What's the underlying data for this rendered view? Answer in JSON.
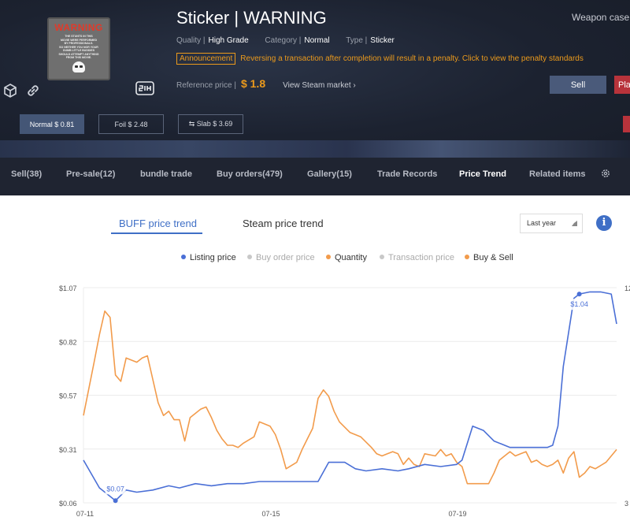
{
  "item": {
    "thumbnail": {
      "warning": "WARNING",
      "lines": [
        "THE STUNTS IN THIS",
        "MOVIE WERE PERFORMED",
        "BY PROFESSIONALS.",
        "SO NEITHER YOU NOR YOUR",
        "DUMB LITTLE BUDDIES",
        "SHOULD ATTEMPT ANYTHING",
        "FROM THIS MOVIE."
      ]
    },
    "title": "Sticker | WARNING",
    "weapon_case": "Weapon case",
    "quality_label": "Quality |",
    "quality": "High Grade",
    "category_label": "Category |",
    "category": "Normal",
    "type_label": "Type |",
    "type": "Sticker",
    "announcement_tag": "Announcement",
    "announcement_text": "Reversing a transaction after completion will result in a penalty. Click to view the penalty standards",
    "reference_label": "Reference price |",
    "reference_price": "$ 1.8",
    "view_steam": "View Steam market ›",
    "sell_button": "Sell",
    "place_button": "Pla"
  },
  "variants": [
    {
      "label": "Normal $ 0.81",
      "active": true
    },
    {
      "label": "Foil $ 2.48",
      "active": false
    },
    {
      "label": "⇆ Slab $ 3.69",
      "active": false
    }
  ],
  "tabs": [
    "Sell(38)",
    "Pre-sale(12)",
    "bundle trade",
    "Buy orders(479)",
    "Gallery(15)",
    "Trade Records",
    "Price Trend",
    "Related items"
  ],
  "active_tab": "Price Trend",
  "chart_controls": {
    "buff_toggle": "BUFF price trend",
    "steam_toggle": "Steam price trend",
    "range": "Last year"
  },
  "legend": [
    {
      "name": "Listing price",
      "color": "#4a6fd6",
      "active": true
    },
    {
      "name": "Buy order price",
      "color": "#c8c8c8",
      "active": false
    },
    {
      "name": "Quantity",
      "color": "#f29b4b",
      "active": true
    },
    {
      "name": "Transaction price",
      "color": "#c8c8c8",
      "active": false
    },
    {
      "name": "Buy & Sell",
      "color": "#f29b4b",
      "active": true
    }
  ],
  "chart_data": {
    "type": "line",
    "y_ticks": [
      "$1.07",
      "$0.82",
      "$0.57",
      "$0.31",
      "$0.06"
    ],
    "ylim": [
      0.06,
      1.07
    ],
    "right_ticks": [
      "12",
      "3"
    ],
    "x_ticks": [
      "07-11",
      "07-15",
      "07-19"
    ],
    "grid": true,
    "annotations": [
      {
        "label": "$0.07",
        "series": "Listing price",
        "x": 6,
        "y": 0.07
      },
      {
        "label": "$1.04",
        "series": "Listing price",
        "x": 93,
        "y": 1.04
      }
    ],
    "series": [
      {
        "name": "Listing price",
        "color": "#4a6fd6",
        "x": [
          0,
          3,
          6,
          8,
          10,
          13,
          16,
          18,
          21,
          24,
          27,
          30,
          33,
          36,
          40,
          44,
          46,
          47,
          49,
          51,
          53,
          56,
          59,
          61,
          64,
          67,
          70,
          71,
          73,
          75,
          77,
          80,
          82,
          85,
          87,
          88,
          89,
          90,
          92,
          93,
          95,
          97,
          99,
          100
        ],
        "y": [
          0.26,
          0.13,
          0.07,
          0.12,
          0.11,
          0.12,
          0.14,
          0.13,
          0.15,
          0.14,
          0.15,
          0.15,
          0.16,
          0.16,
          0.16,
          0.16,
          0.25,
          0.25,
          0.25,
          0.22,
          0.21,
          0.22,
          0.21,
          0.22,
          0.24,
          0.23,
          0.24,
          0.26,
          0.42,
          0.4,
          0.35,
          0.32,
          0.32,
          0.32,
          0.32,
          0.33,
          0.42,
          0.7,
          1.02,
          1.04,
          1.05,
          1.05,
          1.04,
          0.9
        ]
      },
      {
        "name": "Buy & Sell",
        "color": "#f29b4b",
        "x": [
          0,
          2,
          3,
          4,
          5,
          6,
          7,
          8,
          10,
          11,
          12,
          14,
          15,
          16,
          17,
          18,
          19,
          20,
          22,
          23,
          24,
          25,
          26,
          27,
          28,
          29,
          30,
          32,
          33,
          34,
          35,
          36,
          37,
          38,
          40,
          41,
          42,
          43,
          44,
          45,
          46,
          47,
          48,
          50,
          52,
          54,
          55,
          56,
          57,
          58,
          59,
          60,
          61,
          62,
          63,
          64,
          66,
          67,
          68,
          69,
          70,
          71,
          72,
          74,
          76,
          77,
          78,
          79,
          80,
          81,
          82,
          83,
          84,
          85,
          86,
          87,
          88,
          89,
          90,
          91,
          92,
          93,
          94,
          95,
          96,
          98,
          100
        ],
        "y": [
          0.47,
          0.72,
          0.85,
          0.96,
          0.93,
          0.66,
          0.63,
          0.74,
          0.72,
          0.74,
          0.75,
          0.53,
          0.47,
          0.49,
          0.45,
          0.45,
          0.35,
          0.46,
          0.5,
          0.51,
          0.46,
          0.4,
          0.36,
          0.33,
          0.33,
          0.32,
          0.34,
          0.37,
          0.44,
          0.43,
          0.42,
          0.38,
          0.31,
          0.22,
          0.25,
          0.31,
          0.36,
          0.41,
          0.55,
          0.59,
          0.56,
          0.49,
          0.44,
          0.39,
          0.37,
          0.32,
          0.29,
          0.28,
          0.29,
          0.3,
          0.29,
          0.24,
          0.27,
          0.24,
          0.23,
          0.29,
          0.28,
          0.31,
          0.28,
          0.29,
          0.25,
          0.23,
          0.15,
          0.15,
          0.15,
          0.2,
          0.26,
          0.28,
          0.3,
          0.28,
          0.29,
          0.3,
          0.25,
          0.26,
          0.24,
          0.23,
          0.24,
          0.26,
          0.2,
          0.27,
          0.3,
          0.18,
          0.2,
          0.23,
          0.22,
          0.25,
          0.31
        ]
      }
    ]
  }
}
